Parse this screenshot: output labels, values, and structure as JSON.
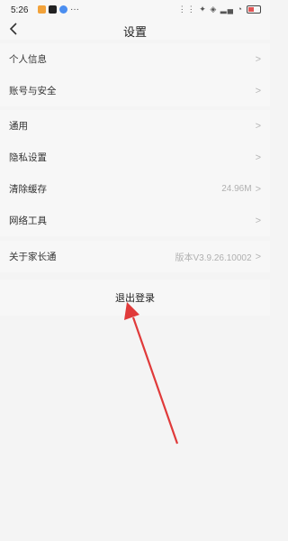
{
  "status": {
    "time": "5:26",
    "dots": "···",
    "right_icons": "⋮⋮ ✦ ◈ ▂▄ ◔"
  },
  "nav": {
    "title": "设置",
    "back_icon": "chevron-left-icon"
  },
  "groups": [
    {
      "rows": [
        {
          "label": "个人信息",
          "value": ""
        },
        {
          "label": "账号与安全",
          "value": ""
        }
      ]
    },
    {
      "rows": [
        {
          "label": "通用",
          "value": ""
        },
        {
          "label": "隐私设置",
          "value": ""
        },
        {
          "label": "清除缓存",
          "value": "24.96M"
        },
        {
          "label": "网络工具",
          "value": ""
        }
      ]
    },
    {
      "rows": [
        {
          "label": "关于家长通",
          "value": "版本V3.9.26.10002"
        }
      ]
    }
  ],
  "logout": {
    "label": "退出登录"
  },
  "annotation": {
    "arrow_color": "#e03a3a"
  }
}
